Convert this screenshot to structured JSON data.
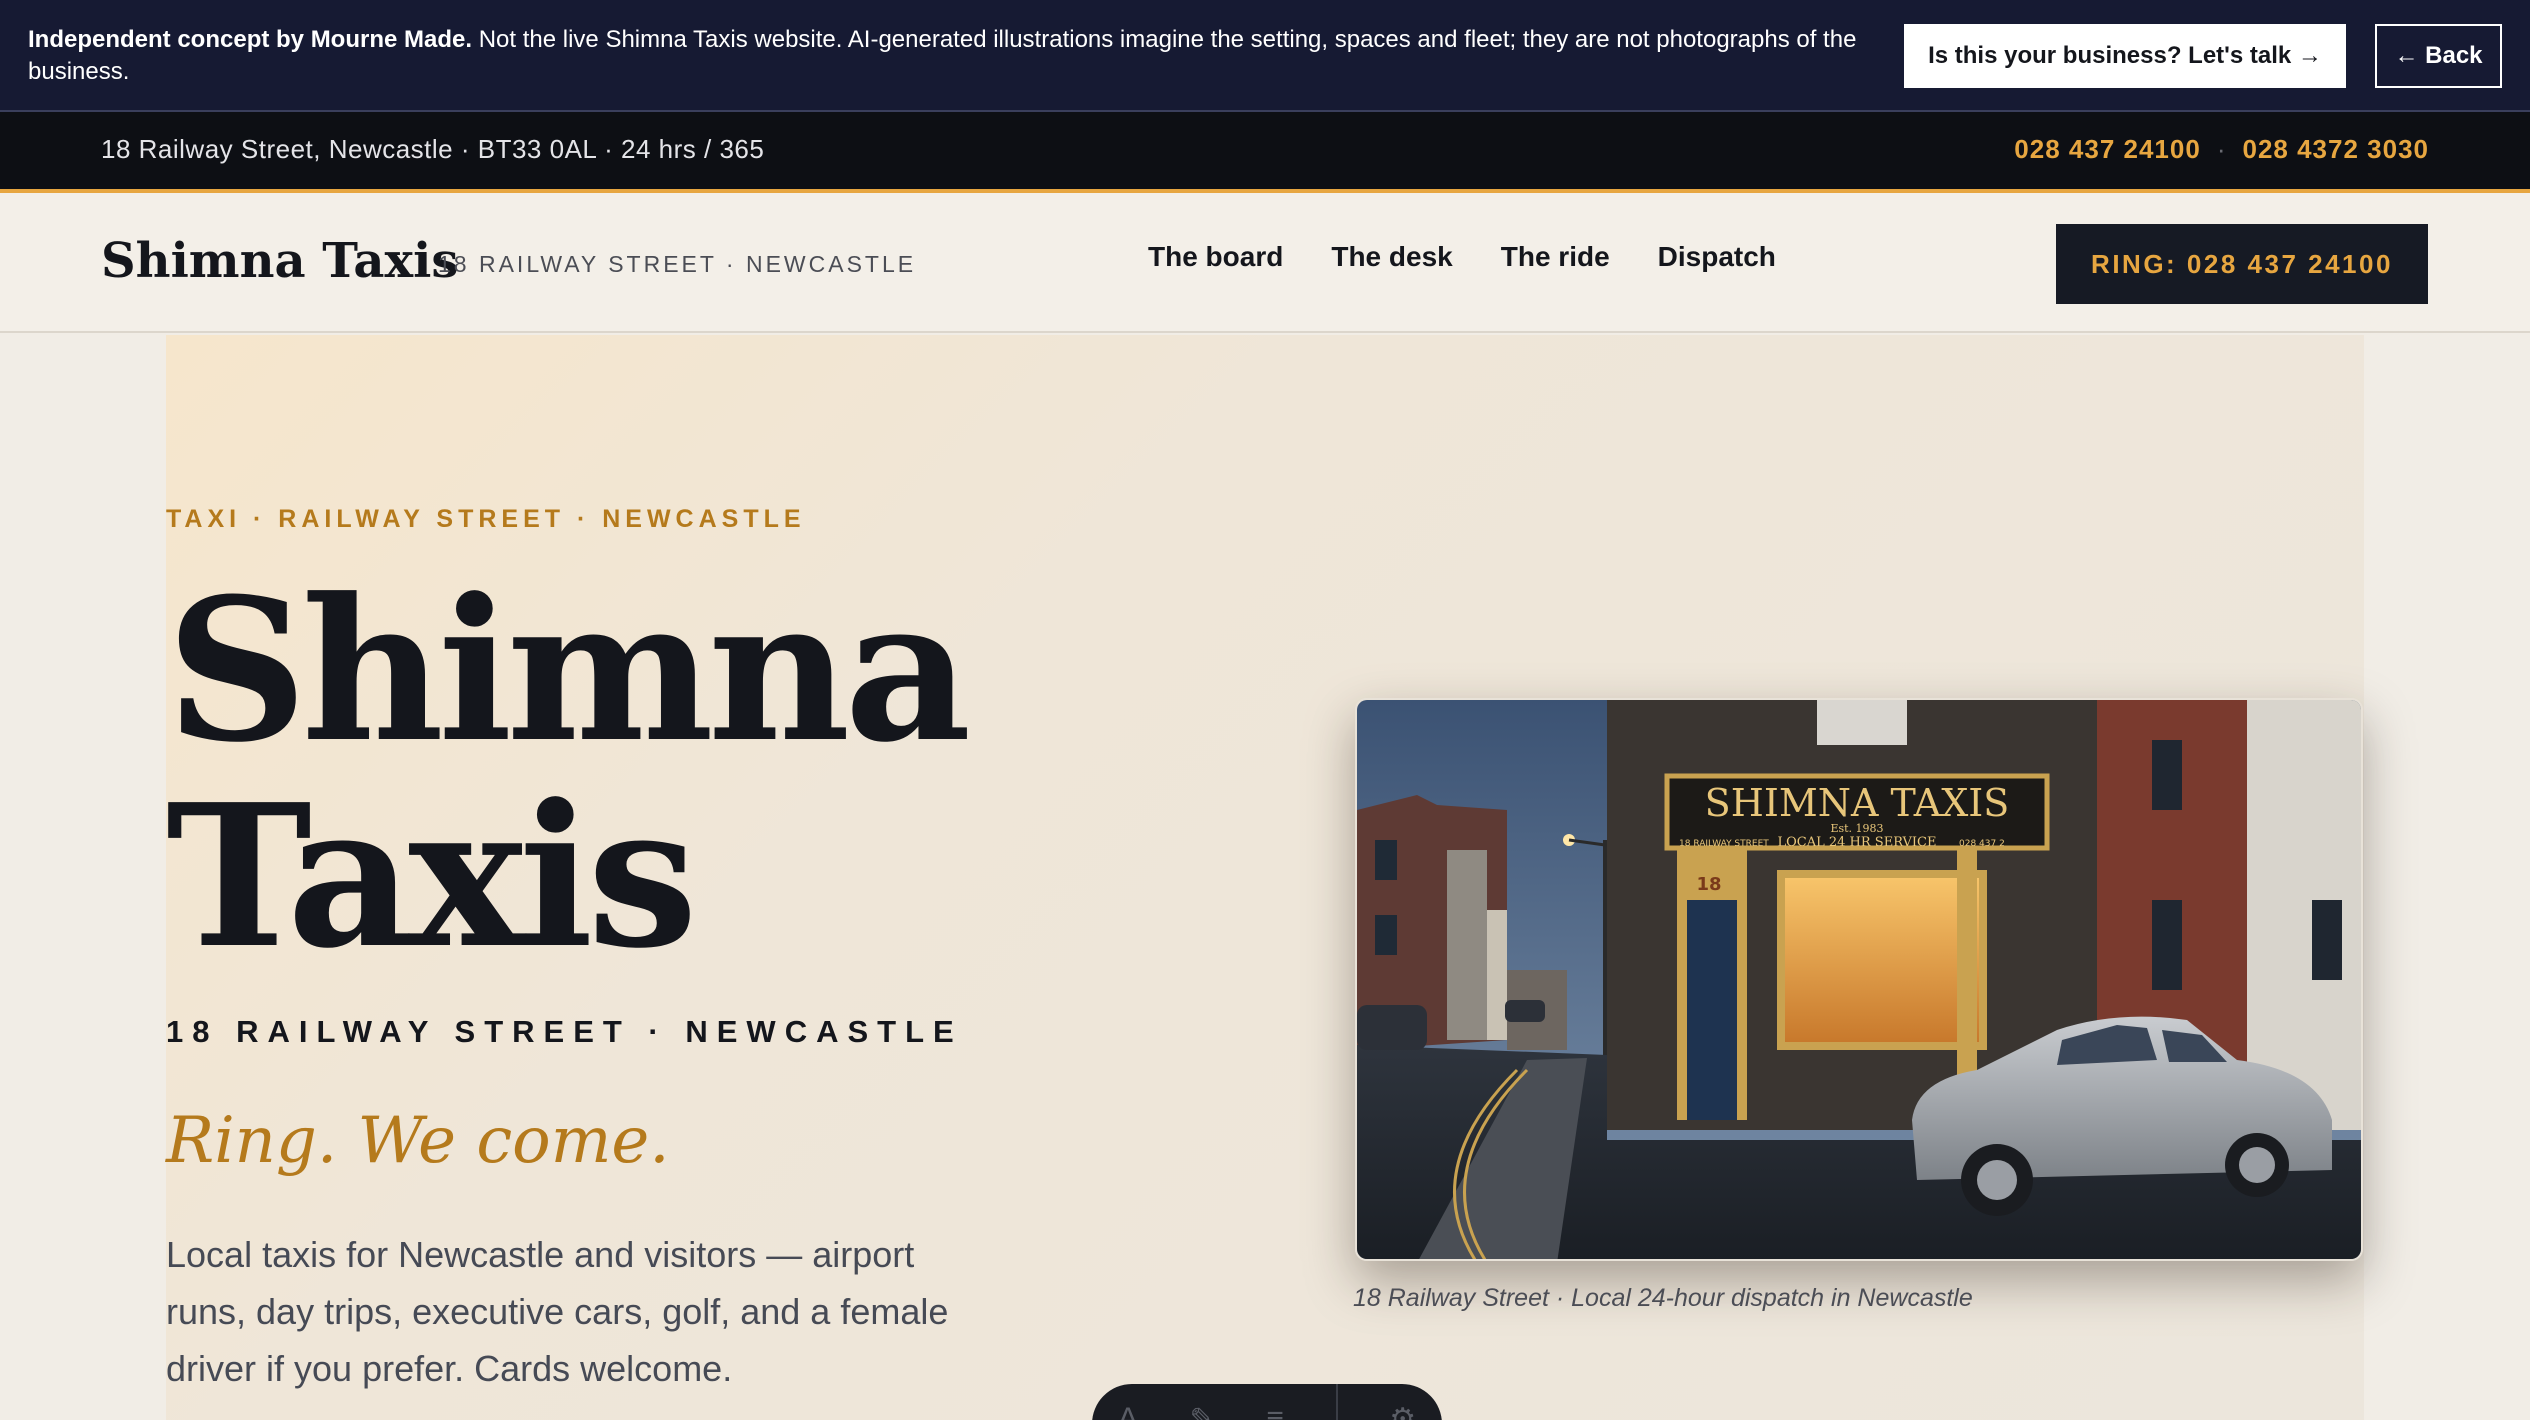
{
  "concept_banner": {
    "bold": "Independent concept by Mourne Made.",
    "text": " Not the live Shimna Taxis website. AI-generated illustrations imagine the setting, spaces and fleet; they are not photographs of the business.",
    "talk_label": "Is this your business? Let's talk →",
    "back_label": "← Back"
  },
  "infobar": {
    "address": "18 Railway Street, Newcastle · BT33 0AL · 24 hrs / 365",
    "phone_1": "028 437 24100",
    "separator": "·",
    "phone_2": "028 4372 3030"
  },
  "header": {
    "brand": "Shimna Taxis",
    "brand_sub": "18 RAILWAY STREET · NEWCASTLE",
    "nav": [
      "The board",
      "The desk",
      "The ride",
      "Dispatch"
    ],
    "ring_label": "RING: 028 437 24100"
  },
  "hero": {
    "eyebrow": "TAXI · RAILWAY STREET · NEWCASTLE",
    "title_line1": "Shimna",
    "title_line2": "Taxis",
    "address": "18 RAILWAY STREET · NEWCASTLE",
    "tagline": "Ring. We come.",
    "description": "Local taxis for Newcastle and visitors — airport runs, day trips, executive cars, golf, and a female driver if you prefer. Cards welcome.",
    "caption": "18 Railway Street · Local 24-hour dispatch in Newcastle",
    "sign_text": "SHIMNA TAXIS",
    "sign_est": "Est. 1983",
    "sign_service": "LOCAL 24 HR SERVICE",
    "sign_left": "18 RAILWAY STREET",
    "sign_phone": "028 437 2",
    "door_number": "18"
  },
  "colors": {
    "accent": "#e7a640",
    "accent_dark": "#b57a1c",
    "navy": "#161a33",
    "ink": "#14161c"
  },
  "icons": [
    "text-tool-icon",
    "pen-icon",
    "menu-lines-icon",
    "settings-gear-icon"
  ]
}
